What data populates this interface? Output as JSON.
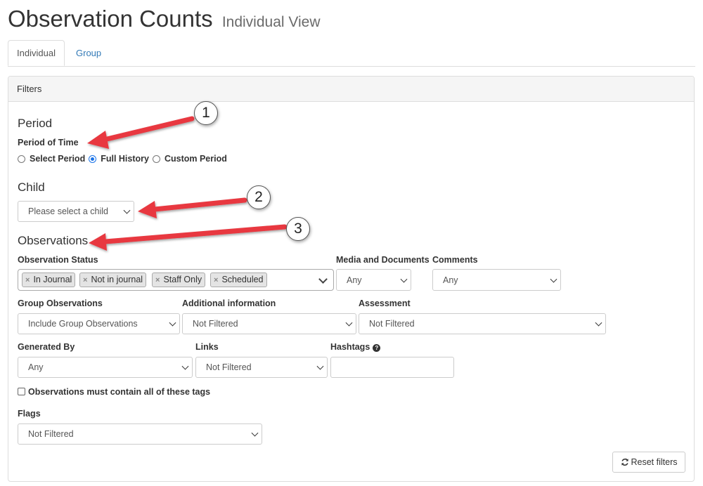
{
  "page": {
    "title": "Observation Counts",
    "subtitle": "Individual View"
  },
  "tabs": [
    {
      "label": "Individual",
      "active": true
    },
    {
      "label": "Group",
      "active": false
    }
  ],
  "filters": {
    "panel_title": "Filters",
    "period": {
      "heading": "Period",
      "label": "Period of Time",
      "options": [
        {
          "label": "Select Period",
          "selected": false
        },
        {
          "label": "Full History",
          "selected": true
        },
        {
          "label": "Custom Period",
          "selected": false
        }
      ]
    },
    "child": {
      "heading": "Child",
      "placeholder": "Please select a child"
    },
    "observations": {
      "heading": "Observations",
      "status": {
        "label": "Observation Status",
        "tags": [
          "In Journal",
          "Not in journal",
          "Staff Only",
          "Scheduled"
        ]
      },
      "media": {
        "label": "Media and Documents",
        "value": "Any"
      },
      "comments": {
        "label": "Comments",
        "value": "Any"
      },
      "group_observations": {
        "label": "Group Observations",
        "value": "Include Group Observations"
      },
      "additional_information": {
        "label": "Additional information",
        "value": "Not Filtered"
      },
      "assessment": {
        "label": "Assessment",
        "value": "Not Filtered"
      },
      "generated_by": {
        "label": "Generated By",
        "value": "Any"
      },
      "links": {
        "label": "Links",
        "value": "Not Filtered"
      },
      "hashtags": {
        "label": "Hashtags",
        "value": ""
      },
      "must_contain_all_tags": {
        "label": "Observations must contain all of these tags",
        "checked": false
      },
      "flags": {
        "label": "Flags",
        "value": "Not Filtered"
      }
    },
    "reset_label": "Reset filters"
  },
  "annotations": {
    "badges": [
      "1",
      "2",
      "3"
    ],
    "arrow_color": "#e8373f"
  },
  "colors": {
    "link": "#337ab7",
    "radio_selected": "#1a73e8"
  }
}
